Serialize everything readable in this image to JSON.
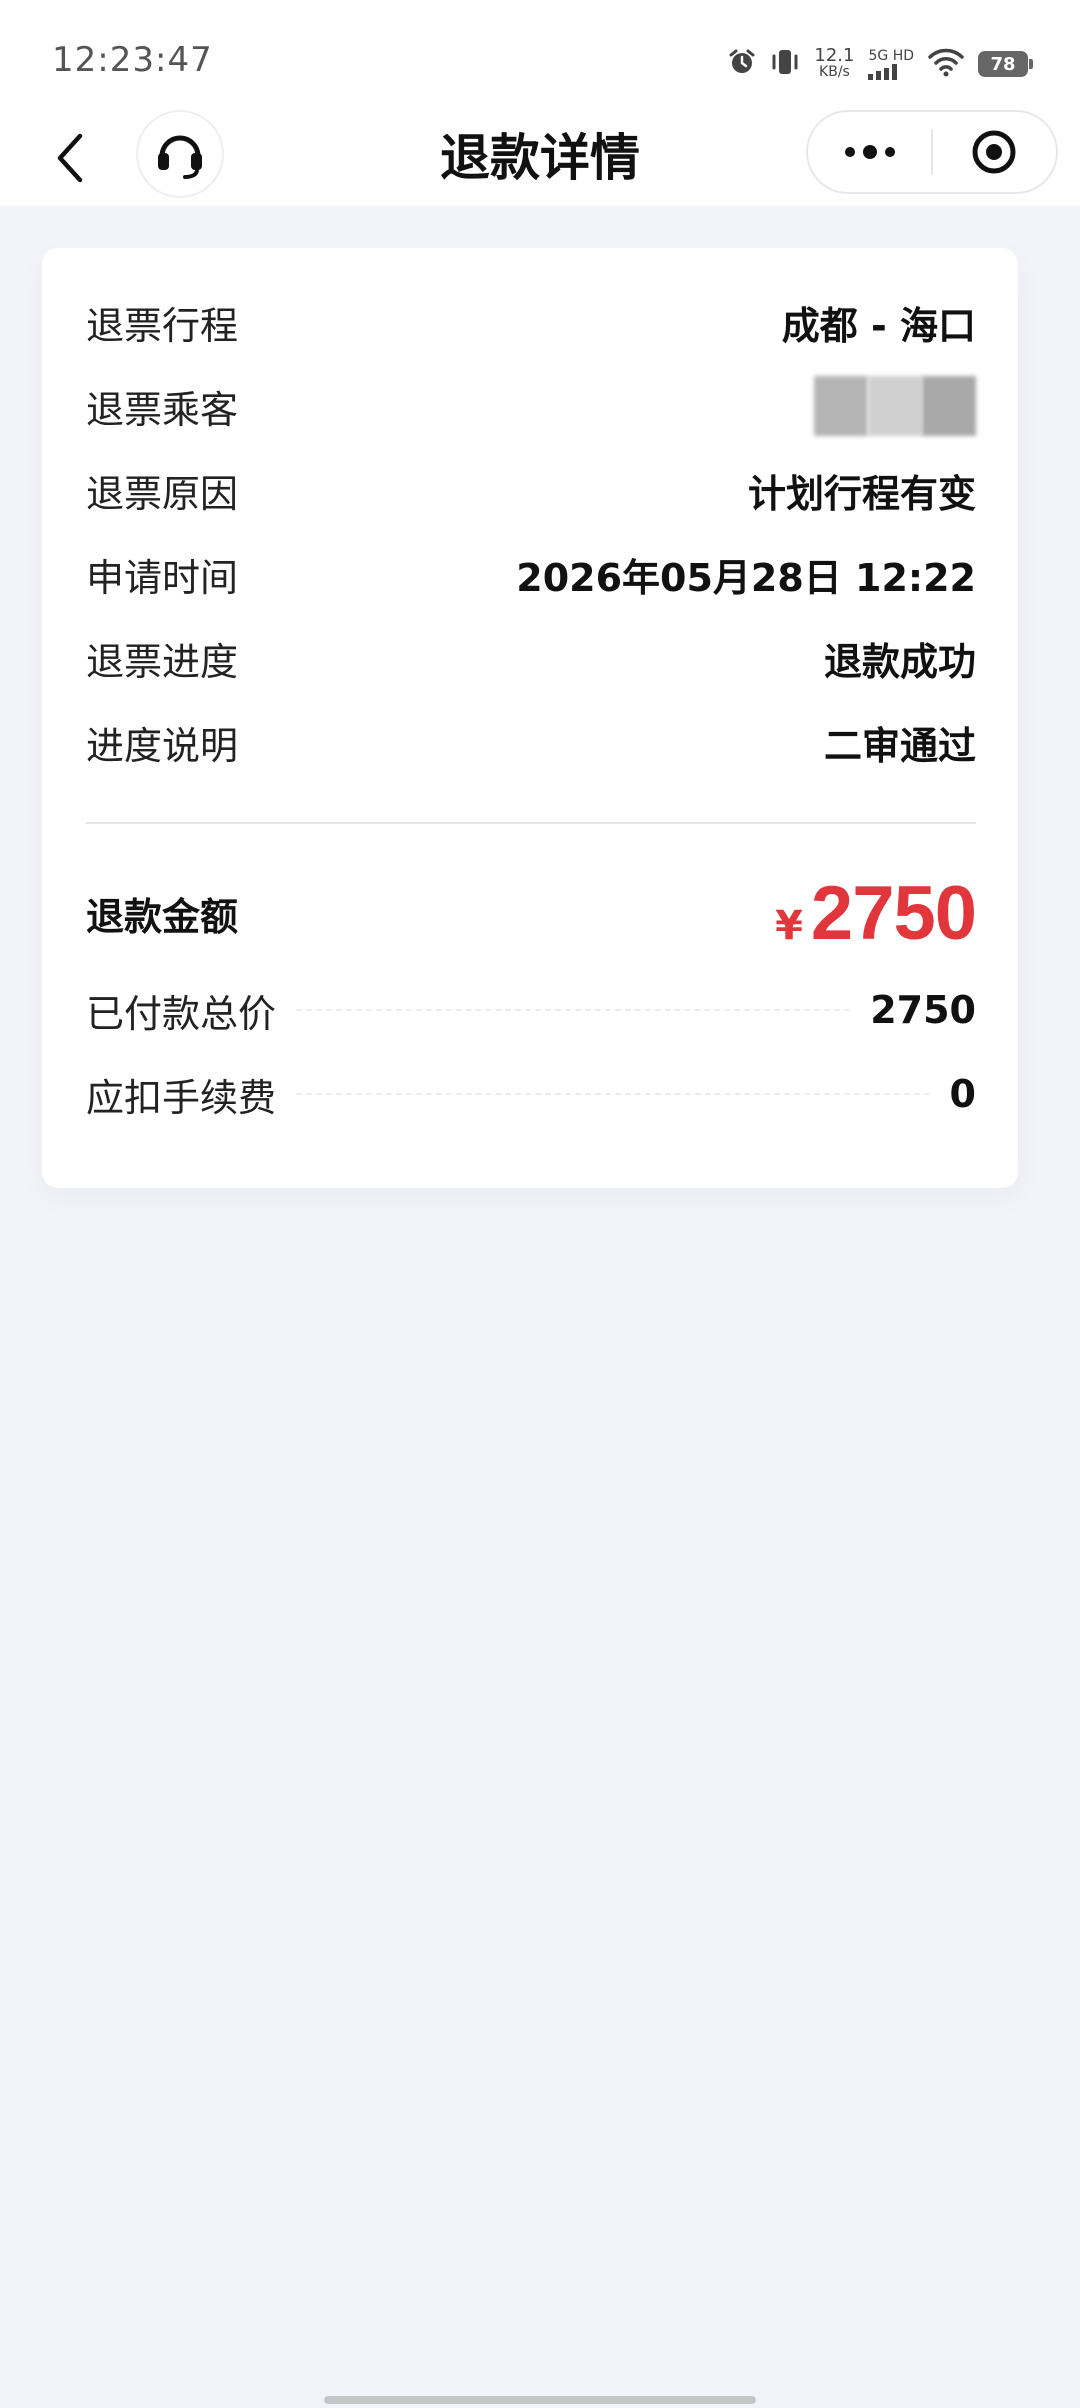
{
  "status_bar": {
    "time": "12:23:47",
    "speed_value": "12.1",
    "speed_unit": "KB/s",
    "network": "5G HD",
    "battery": "78"
  },
  "nav": {
    "title": "退款详情"
  },
  "details": [
    {
      "label": "退票行程",
      "value": "成都 - 海口"
    },
    {
      "label": "退票乘客",
      "value": ""
    },
    {
      "label": "退票原因",
      "value": "计划行程有变"
    },
    {
      "label": "申请时间",
      "value": "2026年05月28日 12:22"
    },
    {
      "label": "退票进度",
      "value": "退款成功"
    },
    {
      "label": "进度说明",
      "value": "二审通过"
    }
  ],
  "refund": {
    "label": "退款金额",
    "currency": "¥",
    "amount": "2750",
    "accent_color": "#e0363c"
  },
  "fees": [
    {
      "label": "已付款总价",
      "value": "2750"
    },
    {
      "label": "应扣手续费",
      "value": "0"
    }
  ]
}
